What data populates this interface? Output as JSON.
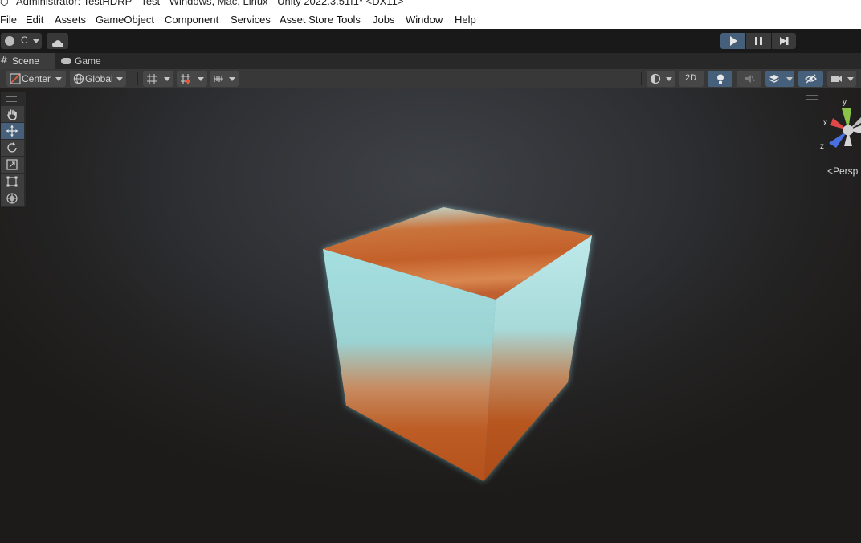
{
  "window": {
    "title": "Administrator: TestHDRP - Test - Windows, Mac, Linux - Unity 2022.3.51f1* <DX11>"
  },
  "menu": [
    "File",
    "Edit",
    "Assets",
    "GameObject",
    "Component",
    "Services",
    "Asset Store Tools",
    "Jobs",
    "Window",
    "Help"
  ],
  "toolbar": {
    "account_label": "C",
    "account_icon": "user-icon",
    "cloud_icon": "cloud-icon",
    "play_icon": "play-icon",
    "pause_icon": "pause-icon",
    "step_icon": "step-icon",
    "play_active_color": "#46607c"
  },
  "tabs": [
    {
      "label": "Scene",
      "icon": "grid-icon",
      "active": true
    },
    {
      "label": "Game",
      "icon": "gamepad-icon",
      "active": false
    }
  ],
  "scene_toolbar": {
    "pivot_label": "Center",
    "space_label": "Global",
    "mode_2d_label": "2D"
  },
  "tools": [
    "hand-tool",
    "move-tool",
    "rotate-tool",
    "scale-tool",
    "rect-tool",
    "transform-tool"
  ],
  "active_tool": "move-tool",
  "gizmo": {
    "y_label": "y",
    "x_label": "x",
    "z_label": "z",
    "projection_label": "<Persp",
    "colors": {
      "y": "#8bc34a",
      "x": "#e04848",
      "z": "#4a6fe0"
    }
  },
  "cube": {
    "top_color": "#c4602a",
    "band_color": "#a6dfe0",
    "bottom_color": "#b9541e"
  }
}
